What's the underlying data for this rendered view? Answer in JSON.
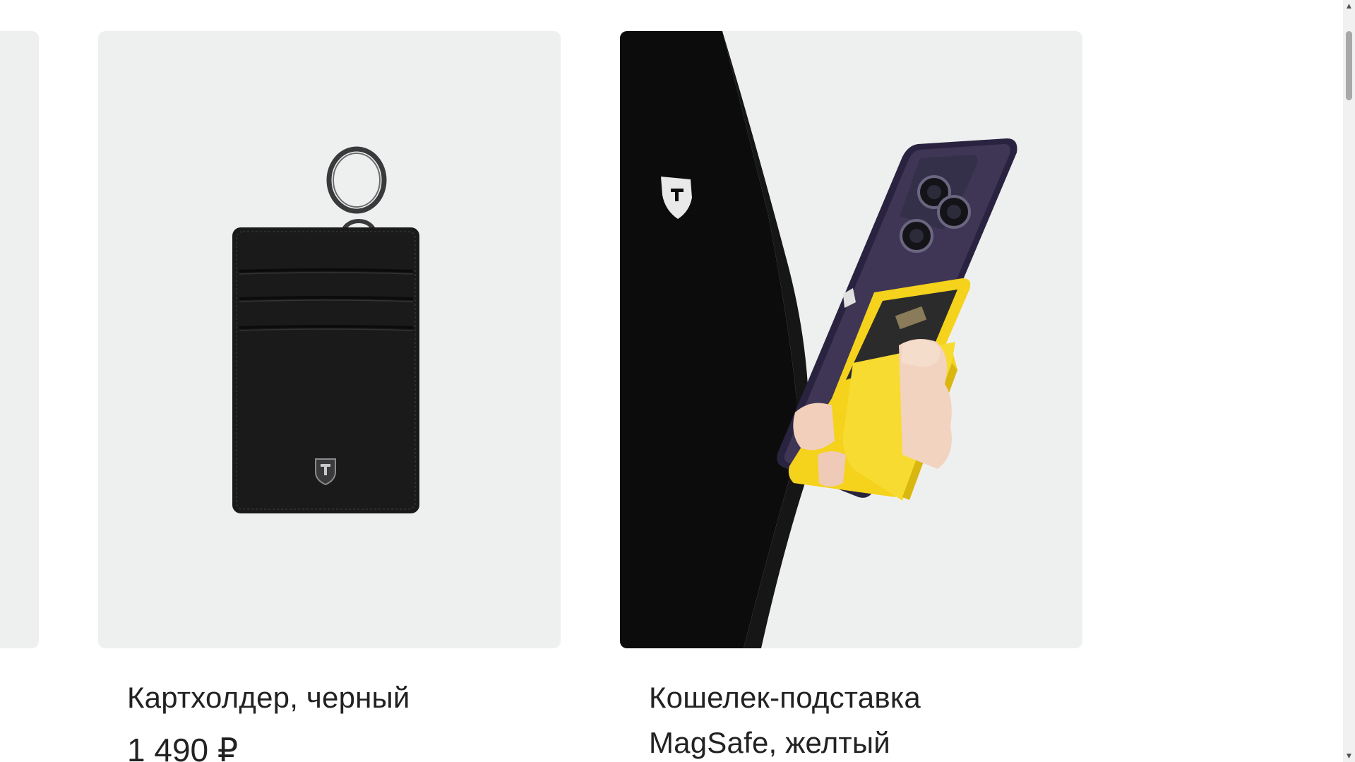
{
  "products": [
    {
      "title": "Картхолдер, черный",
      "price": "1 490 ₽",
      "image_icon": "card-holder-image"
    },
    {
      "title": "Кошелек-подставка MagSafe, желтый",
      "price": "",
      "image_icon": "magsafe-wallet-image"
    }
  ],
  "colors": {
    "card_background": "#eef0f0",
    "text": "#222222",
    "accent_yellow": "#f5d21c"
  },
  "scrollbar": {
    "up_arrow": "▲",
    "down_arrow": "▼"
  }
}
